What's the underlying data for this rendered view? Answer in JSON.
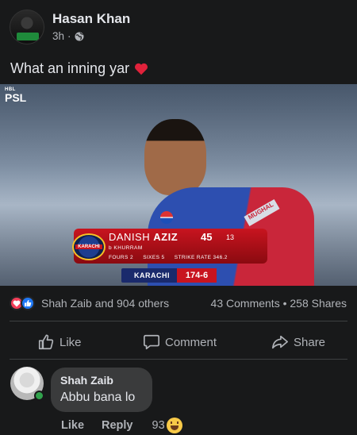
{
  "post": {
    "author": "Hasan Khan",
    "time": "3h",
    "separator": "·",
    "text": "What an inning yar"
  },
  "media": {
    "watermark_small": "HBL",
    "watermark": "PSL",
    "scorecard": {
      "team_logo_label": "KARACHI",
      "batsman_first": "DANISH",
      "batsman_last": "AZIZ",
      "runs": "45",
      "balls": "13",
      "dismissal": "b KHURRAM",
      "fours": "FOURS  2",
      "sixes": "SIXES  5",
      "strike_rate": "STRIKE RATE   346.2",
      "team": "KARACHI",
      "team_score": "174-6"
    },
    "sponsor": "MUGHAL"
  },
  "engagement": {
    "reactors": "Shah Zaib and 904 others",
    "comments": "43 Comments",
    "dot": "•",
    "shares": "258 Shares"
  },
  "actions": {
    "like": "Like",
    "comment": "Comment",
    "share": "Share"
  },
  "comment": {
    "author": "Shah Zaib",
    "text": "Abbu bana lo",
    "like": "Like",
    "reply": "Reply",
    "reaction_count": "93"
  },
  "colors": {
    "background": "#18191a",
    "text": "#e4e6eb",
    "secondary_text": "#b0b3b8",
    "like_blue": "#2078f4",
    "love_red": "#f33e58",
    "bubble": "#3a3b3c",
    "online_green": "#31a24c"
  }
}
